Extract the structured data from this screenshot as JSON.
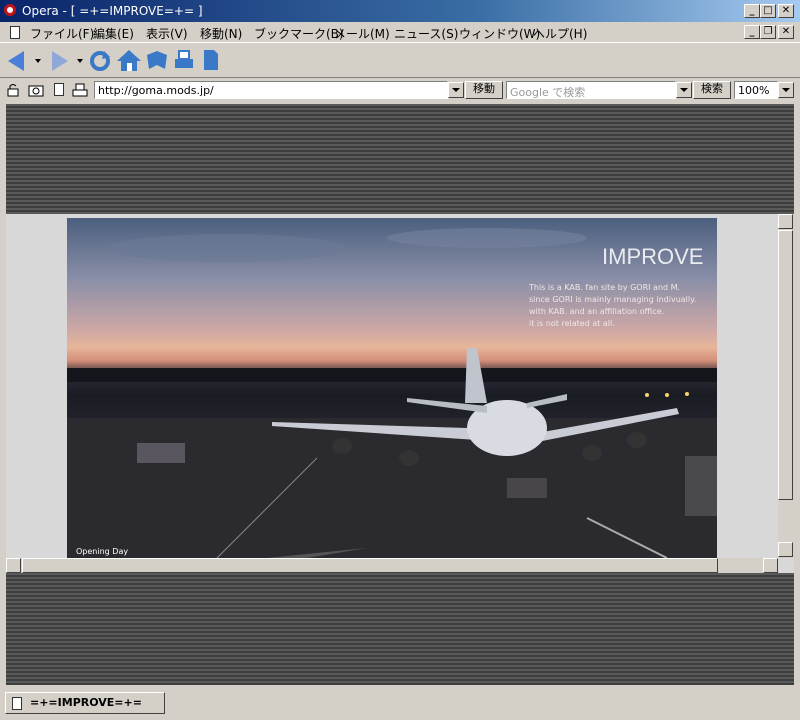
{
  "window": {
    "title": "Opera - [ =+=IMPROVE=+= ]",
    "controls": [
      "minimize",
      "maximize",
      "close"
    ]
  },
  "menu": {
    "items": [
      "ファイル(F)",
      "編集(E)",
      "表示(V)",
      "移動(N)",
      "ブックマーク(B)",
      "メール(M)",
      "ニュース(S)",
      "ウィンドウ(W)",
      "ヘルプ(H)"
    ]
  },
  "toolbar": {
    "icons": [
      "back-icon",
      "forward-icon",
      "reload-icon",
      "home-icon",
      "bookmarks-icon",
      "print-icon",
      "page-icon"
    ]
  },
  "addressbar": {
    "url": "http://goma.mods.jp/",
    "go_label": "移動",
    "search_placeholder": "Google で検索",
    "search_label": "検索",
    "zoom": "100%"
  },
  "page": {
    "title": "IMPROVE",
    "description": [
      "This is a KAB. fan site by GORI and M.",
      "since GORI is mainly managing indivually.",
      "with KAB. and an affillation office.",
      "it is not related at all."
    ],
    "caption": "Opening Day"
  },
  "status": {
    "tab_label": "=+=IMPROVE=+="
  },
  "colors": {
    "titlebar": "#0a246a",
    "chrome": "#d4d0c8",
    "stripe": "#4a4a4a"
  }
}
